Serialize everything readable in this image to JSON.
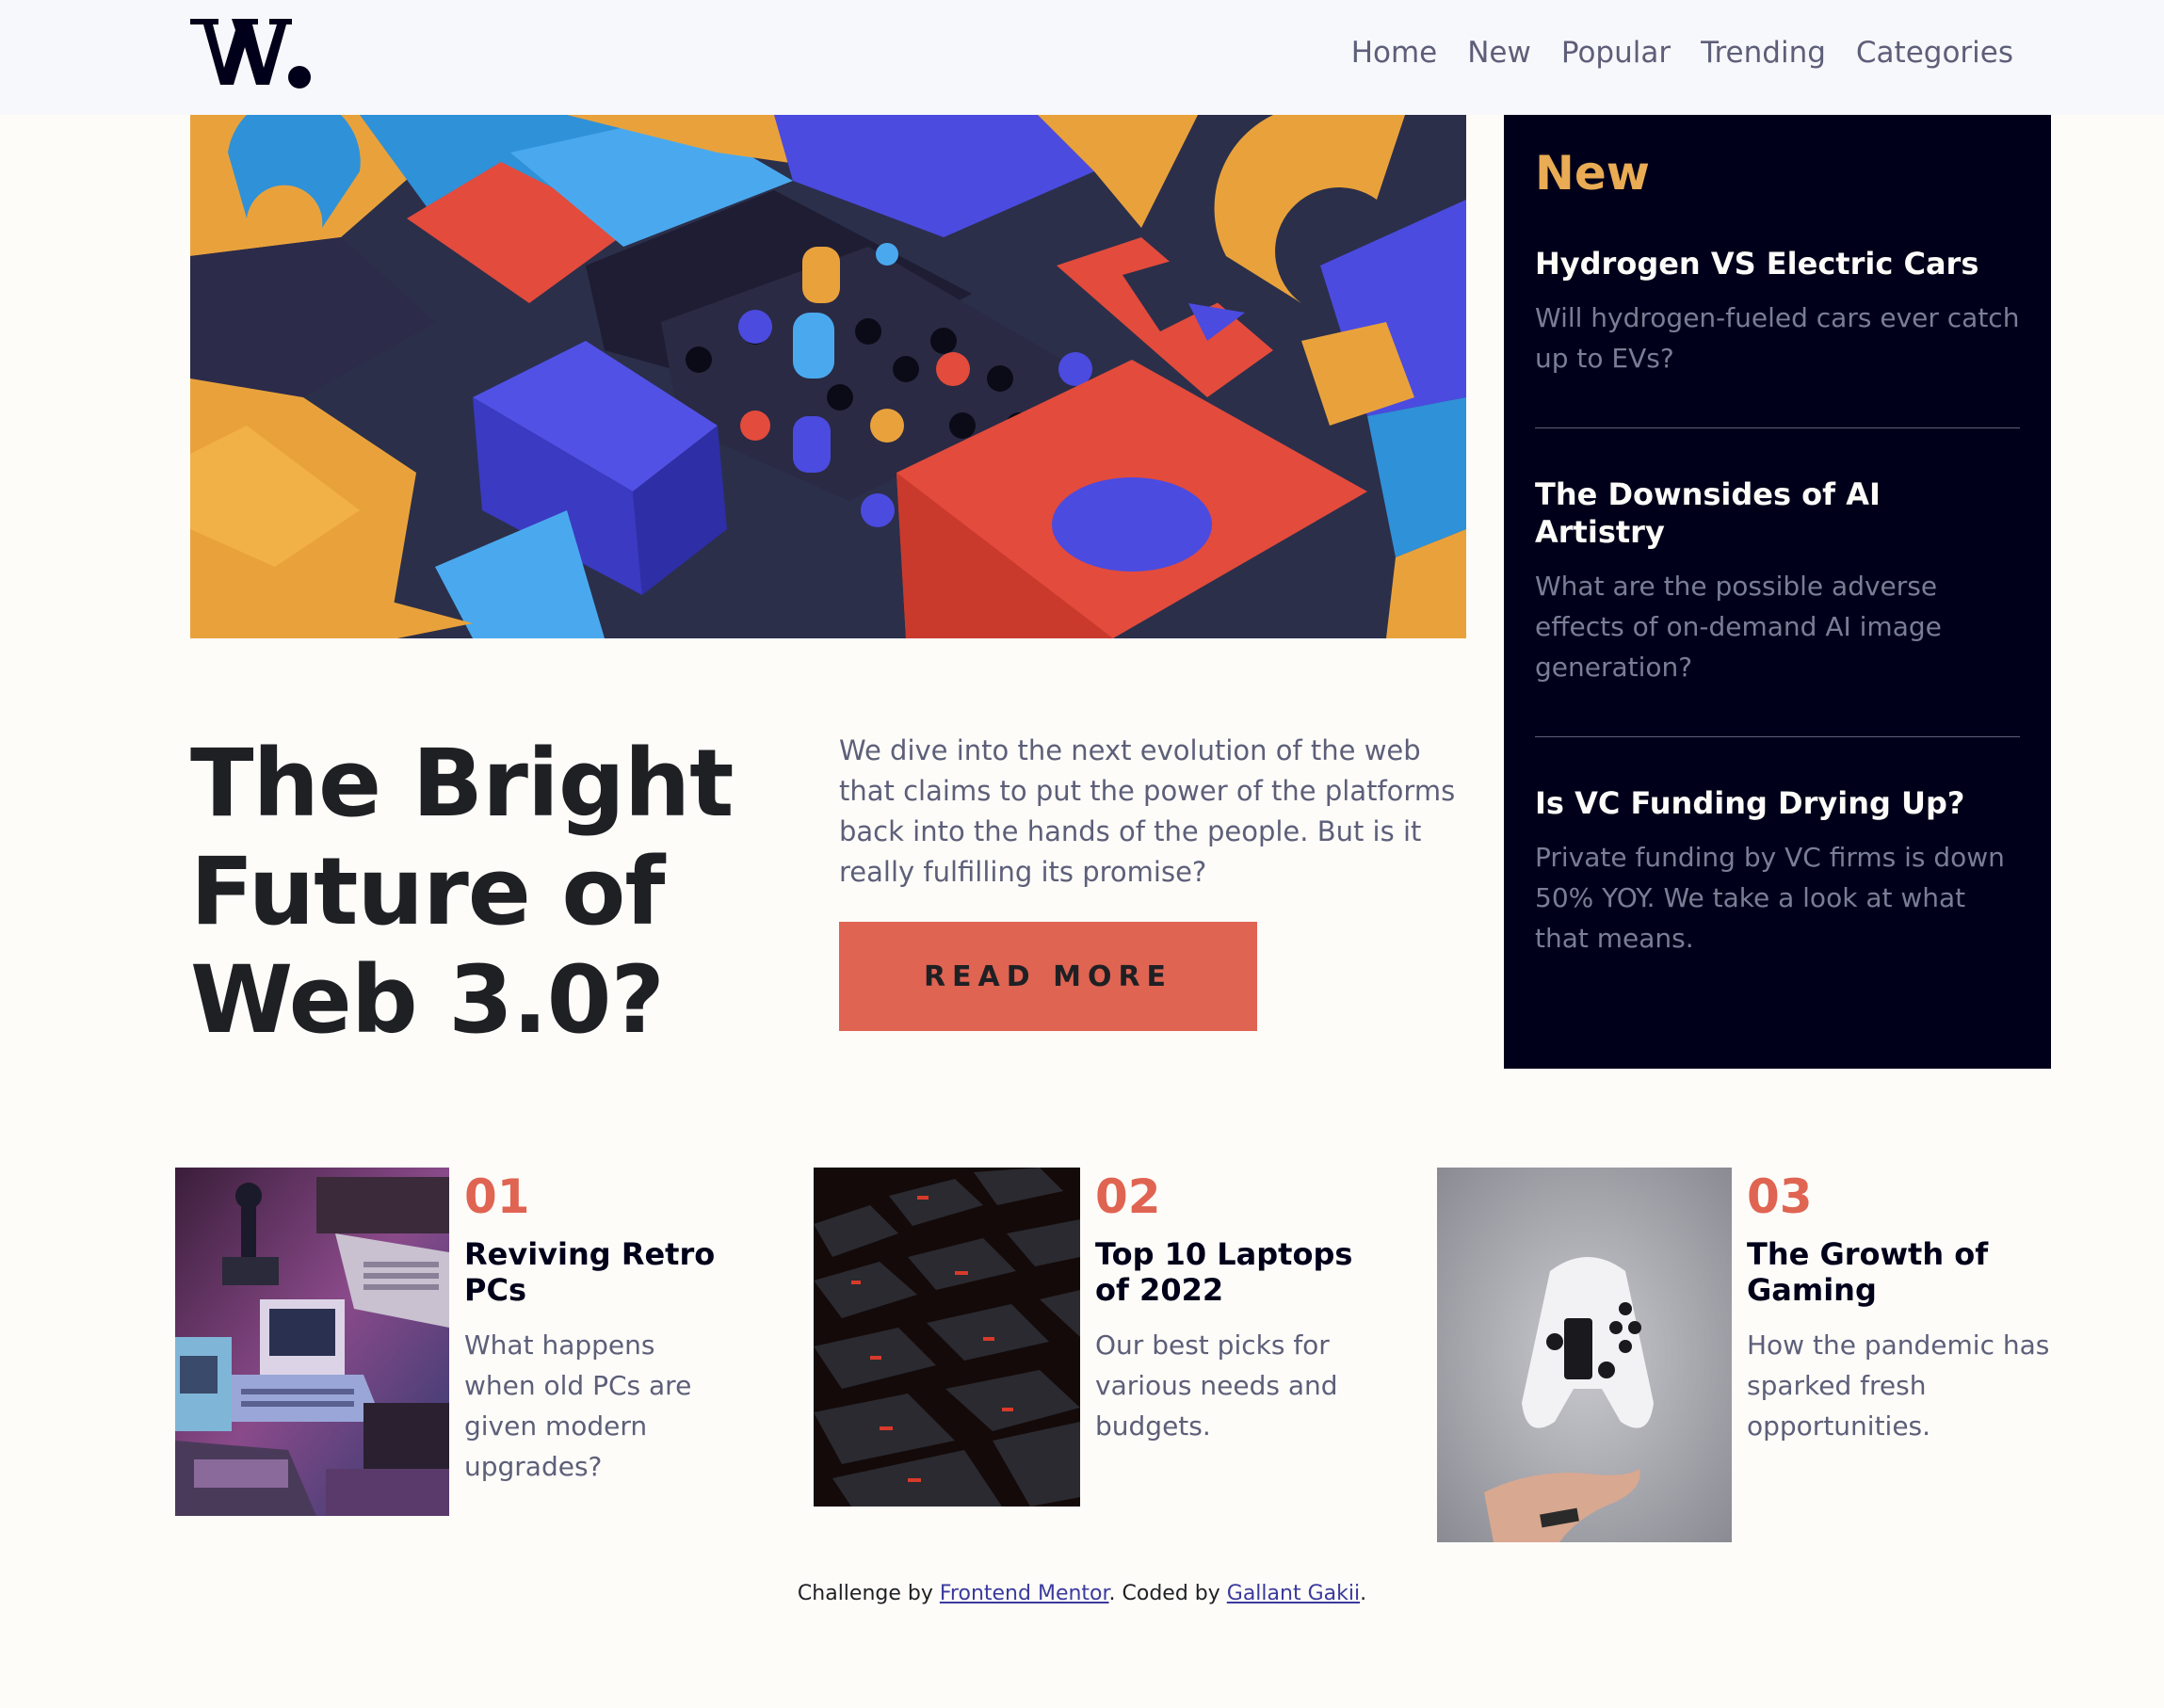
{
  "header": {
    "logo_text": "W.",
    "nav": [
      "Home",
      "New",
      "Popular",
      "Trending",
      "Categories"
    ]
  },
  "hero": {
    "headline_lines": [
      "The Bright",
      "Future of",
      "Web 3.0?"
    ],
    "intro": "We dive into the next evolution of the web that claims to put the power of the platforms back into the hands of the people. But is it really fulfilling its promise?",
    "button_label": "READ MORE"
  },
  "new_panel": {
    "title": "New",
    "items": [
      {
        "title": "Hydrogen VS Electric Cars",
        "desc": "Will hydrogen-fueled cars ever catch up to EVs?"
      },
      {
        "title": "The Downsides of AI Artistry",
        "desc": "What are the possible adverse effects of on-demand AI image generation?"
      },
      {
        "title": "Is VC Funding Drying Up?",
        "desc": "Private funding by VC firms is down 50% YOY. We take a look at what that means."
      }
    ]
  },
  "cards": [
    {
      "num": "01",
      "title": "Reviving Retro PCs",
      "desc": "What happens when old PCs are given modern upgrades?"
    },
    {
      "num": "02",
      "title": "Top 10 Laptops of 2022",
      "desc": "Our best picks for various needs and budgets."
    },
    {
      "num": "03",
      "title": "The Growth of Gaming",
      "desc": "How the pandemic has sparked fresh opportunities."
    }
  ],
  "footer": {
    "prefix": "Challenge by",
    "link1": "Frontend Mentor",
    "middle": ". Coded by",
    "link2": "Gallant Gakii",
    "suffix": "."
  },
  "colors": {
    "accent_red": "#e06452",
    "accent_orange": "#e9ab53",
    "dark_navy": "#00001a",
    "off_white": "#fdfcf9",
    "grayish_blue": "#5d5f79"
  }
}
